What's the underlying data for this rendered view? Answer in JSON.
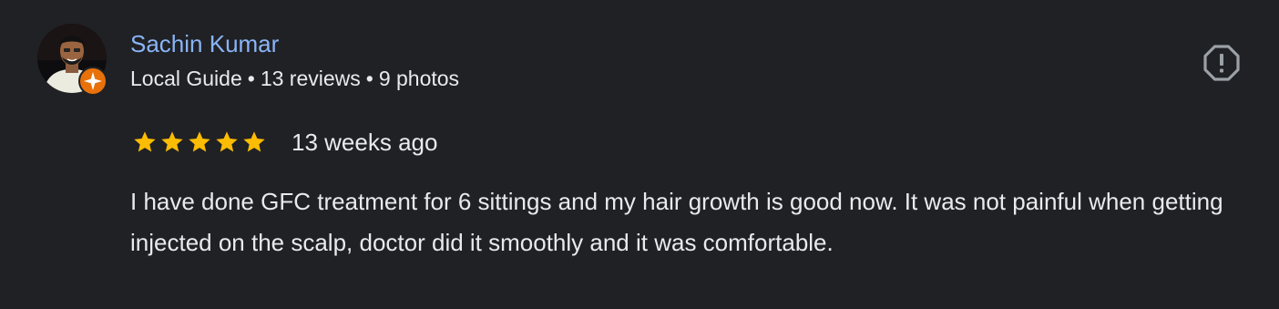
{
  "reviewer": {
    "name": "Sachin Kumar",
    "level": "Local Guide",
    "separator": "•",
    "reviews_count": "13 reviews",
    "photos_count": "9 photos"
  },
  "rating": {
    "value": 5,
    "max": 5,
    "star_color": "#fbbc04"
  },
  "date": "13 weeks ago",
  "review_text": "I have done GFC treatment for 6 sittings and my hair growth is good now. It was not painful when getting injected on the scalp, doctor did it smoothly and it was comfortable.",
  "icons": {
    "report": "report-flag-icon",
    "guide_badge": "local-guide-badge-icon"
  },
  "colors": {
    "background": "#202124",
    "name": "#8ab4f8",
    "text": "#e8eaed",
    "badge": "#e8710a"
  }
}
